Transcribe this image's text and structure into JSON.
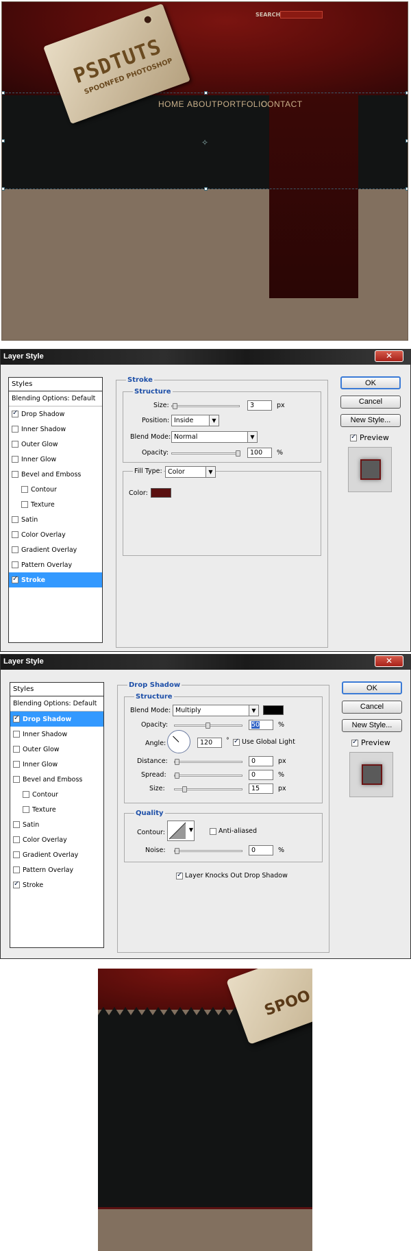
{
  "mockup": {
    "search_label": "SEARCH",
    "tag_title": "PSDTUTS",
    "tag_subtitle": "SPOONFED PHOTOSHOP",
    "nav": [
      "HOME",
      "ABOUT",
      "PORTFOLIO",
      "CONTACT"
    ],
    "colors": {
      "header": "#5a0c0a",
      "dark": "#121414",
      "column": "#320705",
      "body": "#82705f"
    }
  },
  "dialog1": {
    "title": "Layer Style",
    "close": "✕",
    "styles_header": "Styles",
    "blending": "Blending Options: Default",
    "items": [
      {
        "label": "Drop Shadow",
        "checked": true
      },
      {
        "label": "Inner Shadow",
        "checked": false
      },
      {
        "label": "Outer Glow",
        "checked": false
      },
      {
        "label": "Inner Glow",
        "checked": false
      },
      {
        "label": "Bevel and Emboss",
        "checked": false
      },
      {
        "label": "Contour",
        "checked": false
      },
      {
        "label": "Texture",
        "checked": false
      },
      {
        "label": "Satin",
        "checked": false
      },
      {
        "label": "Color Overlay",
        "checked": false
      },
      {
        "label": "Gradient Overlay",
        "checked": false
      },
      {
        "label": "Pattern Overlay",
        "checked": false
      },
      {
        "label": "Stroke",
        "checked": true
      }
    ],
    "panel_title": "Stroke",
    "structure": "Structure",
    "size_label": "Size:",
    "size_value": "3",
    "px": "px",
    "position_label": "Position:",
    "position_value": "Inside",
    "blend_label": "Blend Mode:",
    "blend_value": "Normal",
    "opacity_label": "Opacity:",
    "opacity_value": "100",
    "pct": "%",
    "fill_type_label": "Fill Type:",
    "fill_type_value": "Color",
    "color_label": "Color:",
    "stroke_color": "#5a1010",
    "ok": "OK",
    "cancel": "Cancel",
    "new_style": "New Style...",
    "preview": "Preview"
  },
  "dialog2": {
    "title": "Layer Style",
    "close": "✕",
    "panel_title": "Drop Shadow",
    "structure": "Structure",
    "blend_label": "Blend Mode:",
    "blend_value": "Multiply",
    "shadow_color": "#000000",
    "opacity_label": "Opacity:",
    "opacity_value": "50",
    "angle_label": "Angle:",
    "angle_value": "120",
    "degree": "°",
    "global_light": "Use Global Light",
    "distance_label": "Distance:",
    "distance_value": "0",
    "spread_label": "Spread:",
    "spread_value": "0",
    "size_label": "Size:",
    "size_value": "15",
    "px": "px",
    "pct": "%",
    "quality": "Quality",
    "contour_label": "Contour:",
    "anti_aliased": "Anti-aliased",
    "noise_label": "Noise:",
    "noise_value": "0",
    "knockout": "Layer Knocks Out Drop Shadow",
    "ok": "OK",
    "cancel": "Cancel",
    "new_style": "New Style...",
    "preview": "Preview"
  },
  "crop": {
    "tag_text": "SPOO"
  }
}
